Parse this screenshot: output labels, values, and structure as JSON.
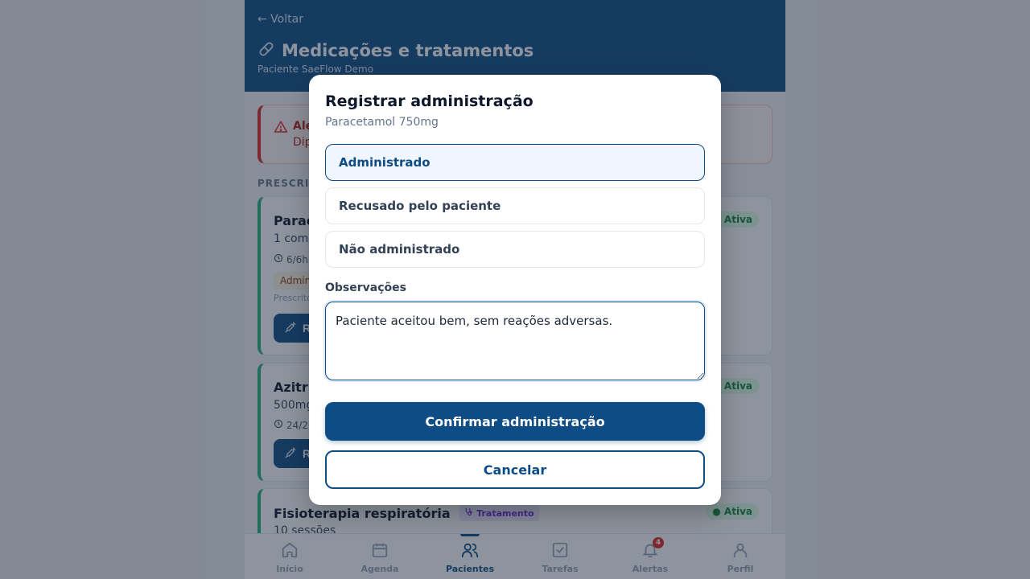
{
  "header": {
    "back_label": "← Voltar",
    "title": "Medicações e tratamentos",
    "title_icon": "pill-icon",
    "subtitle": "Paciente SaeFlow Demo"
  },
  "alert": {
    "title": "Ale",
    "text": "Dip"
  },
  "section_label": "PRESCRIÇ",
  "cards": [
    {
      "name": "Parac",
      "dose": "1 com",
      "freq": "6/6h",
      "tag": "Admin",
      "prescribed": "Prescrito",
      "button_label": "R",
      "status": "● Ativa"
    },
    {
      "name": "Azitr",
      "dose": "500mg",
      "freq": "24/2",
      "button_label": "R",
      "status": "● Ativa"
    },
    {
      "name": "Fisioterapia respiratória",
      "type_tag": "Tratamento",
      "dose": "10 sessões",
      "status": "● Ativa"
    }
  ],
  "tabs": [
    {
      "label": "Início",
      "icon": "home-icon"
    },
    {
      "label": "Agenda",
      "icon": "calendar-icon"
    },
    {
      "label": "Pacientes",
      "icon": "users-icon",
      "active": true
    },
    {
      "label": "Tarefas",
      "icon": "checkbox-icon"
    },
    {
      "label": "Alertas",
      "icon": "bell-icon",
      "badge": "4"
    },
    {
      "label": "Perfil",
      "icon": "user-icon"
    }
  ],
  "modal": {
    "title": "Registrar administração",
    "subtitle": "Paracetamol 750mg",
    "options": [
      {
        "label": "Administrado",
        "selected": true
      },
      {
        "label": "Recusado pelo paciente",
        "selected": false
      },
      {
        "label": "Não administrado",
        "selected": false
      }
    ],
    "observations_label": "Observações",
    "observations_value": "Paciente aceitou bem, sem reações adversas.",
    "confirm_label": "Confirmar administração",
    "cancel_label": "Cancelar"
  },
  "colors": {
    "primary": "#0e4c86",
    "active_status": "#15803d",
    "alert": "#dc2626",
    "treatment": "#6d28d9"
  }
}
